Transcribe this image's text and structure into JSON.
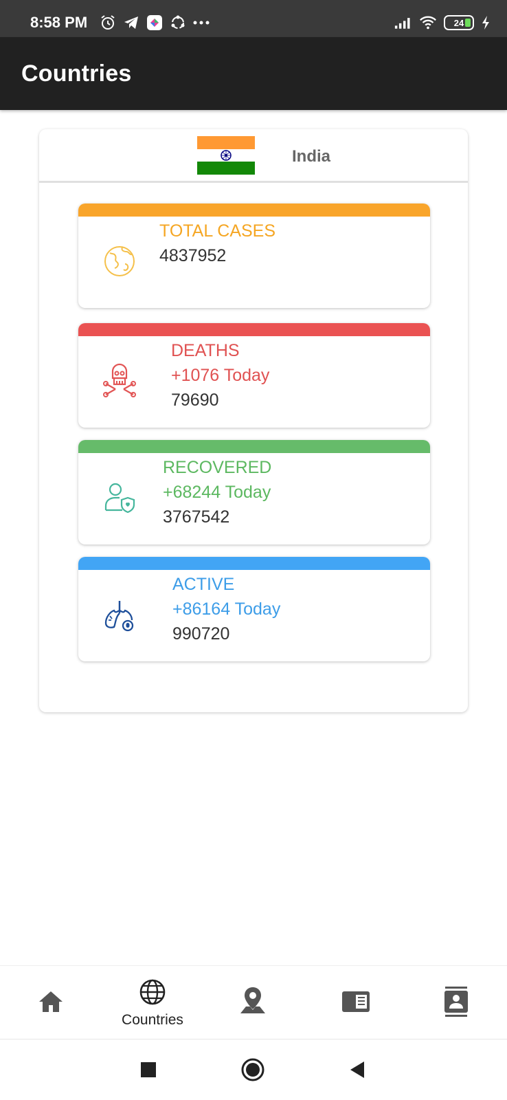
{
  "status_bar": {
    "time": "8:58 PM",
    "battery": "24",
    "icons_left": [
      "alarm-icon",
      "telegram-icon",
      "app-icon",
      "sync-icon",
      "more-dots-icon"
    ],
    "icons_right": [
      "signal-icon",
      "wifi-icon",
      "battery-icon",
      "charging-icon"
    ]
  },
  "app_bar": {
    "title": "Countries"
  },
  "country": {
    "name": "India",
    "flag_colors": [
      "#ff9933",
      "#ffffff",
      "#138808"
    ],
    "chakra_color": "#000080"
  },
  "stats": {
    "total": {
      "label": "TOTAL CASES",
      "value": "4837952",
      "color": "#f5a623",
      "icon": "globe-icon"
    },
    "deaths": {
      "label": "DEATHS",
      "today": "+1076 Today",
      "value": "79690",
      "color": "#e05252",
      "icon": "skull-crossbones-icon"
    },
    "recovered": {
      "label": "RECOVERED",
      "today": "+68244 Today",
      "value": "3767542",
      "color": "#5cb860",
      "icon": "person-shield-icon"
    },
    "active": {
      "label": "ACTIVE",
      "today": "+86164 Today",
      "value": "990720",
      "color": "#3d9de8",
      "icon": "lungs-icon"
    }
  },
  "bottom_nav": {
    "items": [
      {
        "icon": "home-icon",
        "label": ""
      },
      {
        "icon": "globe-icon",
        "label": "Countries"
      },
      {
        "icon": "map-pin-icon",
        "label": ""
      },
      {
        "icon": "news-icon",
        "label": ""
      },
      {
        "icon": "contact-icon",
        "label": ""
      }
    ]
  },
  "system_nav": [
    "recents-button",
    "home-button",
    "back-button"
  ]
}
